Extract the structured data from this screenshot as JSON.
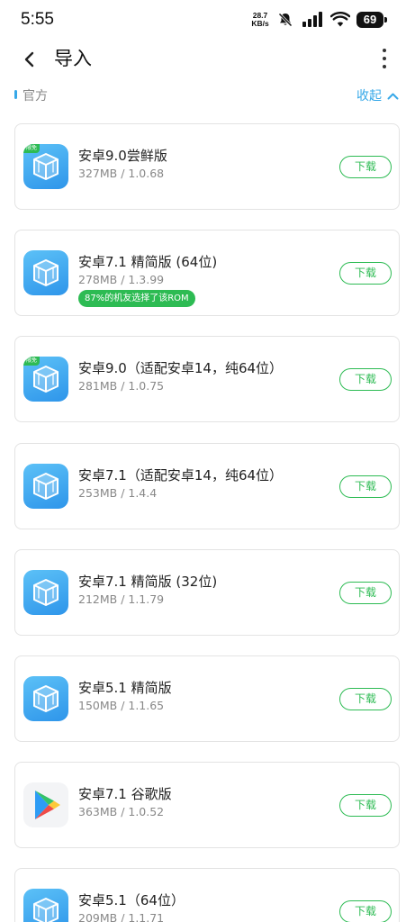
{
  "status_bar": {
    "time": "5:55",
    "net_speed_value": "28.7",
    "net_speed_unit": "KB/s",
    "battery": "69",
    "icons": [
      "mute-bell-icon",
      "signal-icon",
      "wifi-icon",
      "battery-icon"
    ]
  },
  "header": {
    "title": "导入",
    "back_icon": "chevron-left-icon",
    "more_icon": "more-vertical-icon"
  },
  "section": {
    "label": "官方",
    "collapse_label": "收起",
    "collapse_icon": "chevron-up-icon",
    "accent_color": "#36a8e8"
  },
  "colors": {
    "download_green": "#2dbb53",
    "icon_blue": "#2e95ea"
  },
  "roms": [
    {
      "title": "安卓9.0尝鲜版",
      "subtitle": "327MB / 1.0.68",
      "badge": "限免",
      "tag": "",
      "icon": "vm-cube-icon",
      "button": "下载"
    },
    {
      "title": "安卓7.1 精简版 (64位)",
      "subtitle": "278MB / 1.3.99",
      "badge": "",
      "tag": "87%的机友选择了该ROM",
      "icon": "vm-cube-icon",
      "button": "下载"
    },
    {
      "title": "安卓9.0（适配安卓14，纯64位）",
      "subtitle": "281MB / 1.0.75",
      "badge": "限免",
      "tag": "",
      "icon": "vm-cube-icon",
      "button": "下载"
    },
    {
      "title": "安卓7.1（适配安卓14，纯64位）",
      "subtitle": "253MB / 1.4.4",
      "badge": "",
      "tag": "",
      "icon": "vm-cube-icon",
      "button": "下载"
    },
    {
      "title": "安卓7.1 精简版 (32位)",
      "subtitle": "212MB / 1.1.79",
      "badge": "",
      "tag": "",
      "icon": "vm-cube-icon",
      "button": "下载"
    },
    {
      "title": "安卓5.1 精简版",
      "subtitle": "150MB / 1.1.65",
      "badge": "",
      "tag": "",
      "icon": "vm-cube-icon",
      "button": "下载"
    },
    {
      "title": "安卓7.1 谷歌版",
      "subtitle": "363MB / 1.0.52",
      "badge": "",
      "tag": "",
      "icon": "google-play-icon",
      "button": "下载"
    },
    {
      "title": "安卓5.1（64位）",
      "subtitle": "209MB / 1.1.71",
      "badge": "",
      "tag": "",
      "icon": "vm-cube-icon",
      "button": "下载"
    }
  ]
}
